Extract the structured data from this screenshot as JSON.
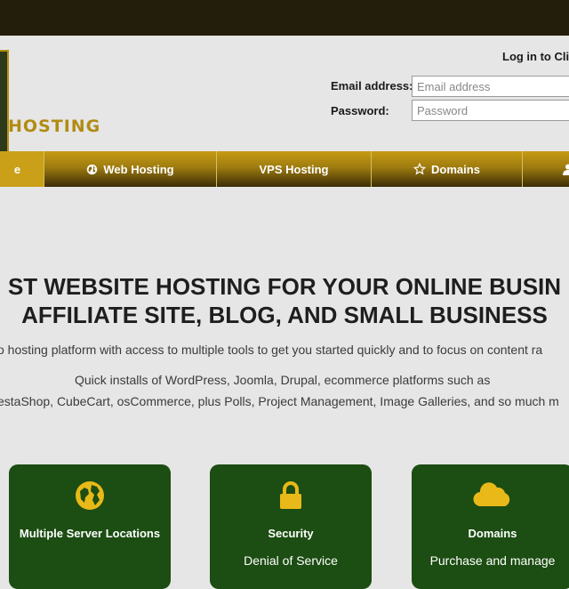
{
  "header": {
    "logo_text": "HOSTING",
    "login_link": "Log in to Cli",
    "email_label": "Email address:",
    "email_placeholder": "Email address",
    "password_label": "Password:",
    "password_placeholder": "Password"
  },
  "nav": {
    "items": [
      {
        "label": "e",
        "icon": "none"
      },
      {
        "label": "Web Hosting",
        "icon": "globe-icon"
      },
      {
        "label": "VPS Hosting",
        "icon": "none"
      },
      {
        "label": "Domains",
        "icon": "star-icon"
      },
      {
        "label": "",
        "icon": "user-icon"
      }
    ]
  },
  "hero": {
    "title_line1": "ST WEBSITE HOSTING FOR YOUR ONLINE BUSIN",
    "title_line2": "AFFILIATE SITE, BLOG, AND SMALL BUSINESS",
    "text_line1": "o hosting platform with access to multiple tools to get you started quickly and to focus on content ra",
    "text_line2": "Quick installs of WordPress, Joomla, Drupal, ecommerce platforms such as",
    "text_line3": "estaShop, CubeCart, osCommerce, plus Polls, Project Management, Image Galleries, and so much m"
  },
  "cards": [
    {
      "icon": "globe-icon",
      "title": "Multiple Server Locations",
      "subtitle": ""
    },
    {
      "icon": "lock-icon",
      "title": "Security",
      "subtitle": "Denial of Service"
    },
    {
      "icon": "cloud-icon",
      "title": "Domains",
      "subtitle": "Purchase and manage"
    }
  ],
  "colors": {
    "top_bar": "#231d0c",
    "nav_gold": "#b58f14",
    "card_green": "#1c4d12",
    "page_bg": "#e6e6e6"
  }
}
